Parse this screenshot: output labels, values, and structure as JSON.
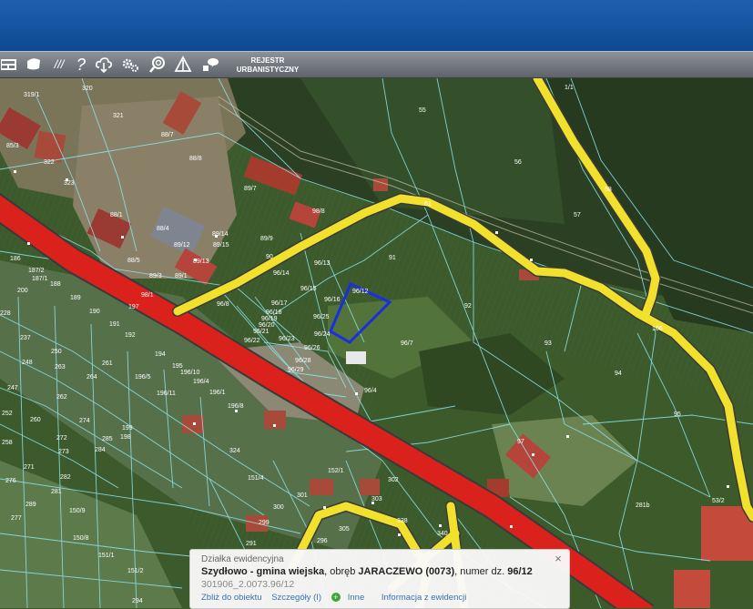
{
  "toolbar": {
    "icons": [
      "layout-icon",
      "selection-icon",
      "measure-icon",
      "help-icon",
      "cloud-download-icon",
      "settings-icon",
      "zoom-icon",
      "sign-icon",
      "comment-icon"
    ],
    "help_label": "?",
    "measure_label": "///",
    "rejestr_line1": "REJESTR",
    "rejestr_line2": "URBANISTYCZNY"
  },
  "map": {
    "colors": {
      "national_road": "#e8201a",
      "road": "#f2e12c",
      "selected_parcel": "#1a2fe0",
      "parcel_line": "#8ee6f0"
    },
    "selected_parcel_label": "96/12",
    "parcels": [
      "319/1",
      "320",
      "321",
      "85/3",
      "322",
      "323",
      "88/7",
      "88/8",
      "89/7",
      "88/1",
      "98/8",
      "88/4",
      "89/14",
      "89/12",
      "89/15",
      "89/9",
      "88/5",
      "89/13",
      "89/3",
      "89/1",
      "186",
      "187/2",
      "187/1",
      "188",
      "200",
      "189",
      "190",
      "228",
      "191",
      "98/1",
      "197",
      "237",
      "250",
      "192",
      "248",
      "263",
      "194",
      "264",
      "195",
      "196/10",
      "196/11",
      "196/4",
      "196/1",
      "196/5",
      "196/8",
      "261",
      "247",
      "262",
      "252",
      "260",
      "274",
      "258",
      "272",
      "273",
      "285",
      "284",
      "324",
      "271",
      "282",
      "199",
      "198",
      "276",
      "151/4",
      "152/1",
      "281",
      "289",
      "277",
      "300",
      "301",
      "302",
      "303",
      "150/9",
      "299",
      "305",
      "150/8",
      "151/1",
      "338",
      "340",
      "151/2",
      "296",
      "291",
      "294",
      "55",
      "1/1",
      "61",
      "56",
      "57",
      "58",
      "90",
      "91",
      "96/13",
      "96/14",
      "96/15",
      "96/16",
      "96/8",
      "96/17",
      "96/18",
      "96/19",
      "96/20",
      "96/21",
      "96/22",
      "96/23",
      "96/24",
      "96/25",
      "96/26",
      "96/28",
      "96/29",
      "96/7",
      "96/4",
      "92",
      "93",
      "94",
      "95",
      "97",
      "106",
      "281b",
      "53/2"
    ],
    "parcels_b": {
      "p281b": "281",
      "p53": "53/2"
    }
  },
  "popup": {
    "title": "Działka ewidencyjna",
    "location": "Szydłowo - gmina wiejska",
    "sep1": ", obręb ",
    "obreb": "JARACZEWO (0073)",
    "sep2": ", numer dz. ",
    "number": "96/12",
    "id": "301906_2.0073.96/12",
    "links": {
      "zoom": "Zbliż do obiektu",
      "details": "Szczegóły (I)",
      "other": "Inne",
      "info": "Informacja z ewidencji"
    },
    "close_label": "×"
  }
}
